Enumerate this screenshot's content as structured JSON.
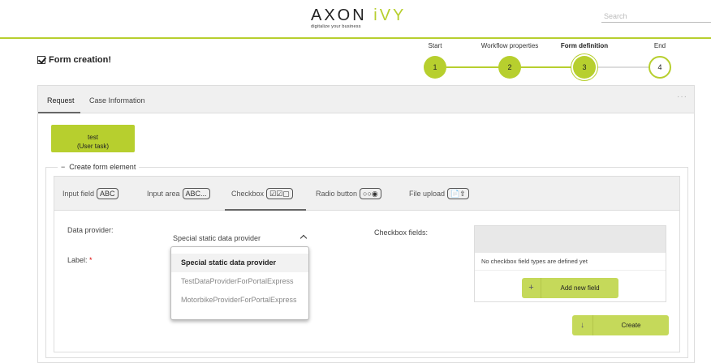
{
  "header": {
    "logo_main": "AXON",
    "logo_accent": "iVY",
    "logo_tagline": "digitalize your business",
    "search_placeholder": "Search"
  },
  "page": {
    "title": "Form creation!"
  },
  "steps": [
    {
      "label": "Start",
      "number": "1"
    },
    {
      "label": "Workflow properties",
      "number": "2"
    },
    {
      "label": "Form definition",
      "number": "3",
      "current": true
    },
    {
      "label": "End",
      "number": "4"
    }
  ],
  "tabs": [
    {
      "label": "Request",
      "active": true
    },
    {
      "label": "Case Information",
      "active": false
    }
  ],
  "more_icon": "···",
  "user_task": {
    "line1": "test",
    "line2": "(User task)"
  },
  "create_section": {
    "legend_toggle": "−",
    "legend": "Create form element",
    "element_tabs": [
      {
        "label": "Input field",
        "icon_text": "ABC"
      },
      {
        "label": "Input area",
        "icon_text": "ABC..."
      },
      {
        "label": "Checkbox",
        "icon_text": "☑☑▢",
        "active": true
      },
      {
        "label": "Radio button",
        "icon_text": "○○◉"
      },
      {
        "label": "File upload",
        "icon_text": "📄⇧"
      }
    ],
    "data_provider_label": "Data provider:",
    "data_provider_value": "Special static data provider",
    "label_label": "Label:",
    "required_mark": "*",
    "dropdown_options": [
      {
        "label": "Special static data provider",
        "selected": true
      },
      {
        "label": "TestDataProviderForPortalExpress",
        "selected": false
      },
      {
        "label": "MotorbikeProviderForPortalExpress",
        "selected": false
      }
    ],
    "checkbox_fields_label": "Checkbox fields:",
    "checkbox_empty_text": "No checkbox field types are defined yet",
    "add_field_icon": "+",
    "add_field_label": "Add new field",
    "create_icon": "↓",
    "create_label": "Create"
  },
  "colors": {
    "accent": "#b7cf2e",
    "button": "#c5d95a"
  }
}
